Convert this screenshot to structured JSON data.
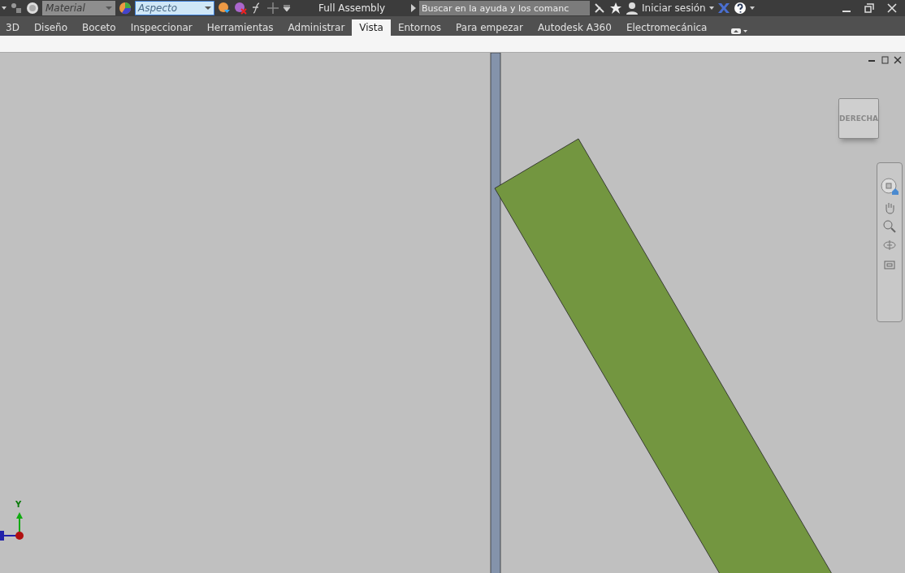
{
  "title_bar": {
    "material": {
      "placeholder": "Material"
    },
    "appearance": {
      "value": "Aspecto"
    },
    "title": "Full Assembly",
    "search": {
      "placeholder": "Buscar en la ayuda y los comanc"
    },
    "sign_in": "Iniciar sesión"
  },
  "tabs": [
    {
      "label": "3D",
      "selected": false
    },
    {
      "label": "Diseño",
      "selected": false
    },
    {
      "label": "Boceto",
      "selected": false
    },
    {
      "label": "Inspeccionar",
      "selected": false
    },
    {
      "label": "Herramientas",
      "selected": false
    },
    {
      "label": "Administrar",
      "selected": false
    },
    {
      "label": "Vista",
      "selected": true
    },
    {
      "label": "Entornos",
      "selected": false
    },
    {
      "label": "Para empezar",
      "selected": false
    },
    {
      "label": "Autodesk A360",
      "selected": false
    },
    {
      "label": "Electromecánica",
      "selected": false
    }
  ],
  "viewport": {
    "view_cube": "DERECHA",
    "axis_label": "Y"
  }
}
